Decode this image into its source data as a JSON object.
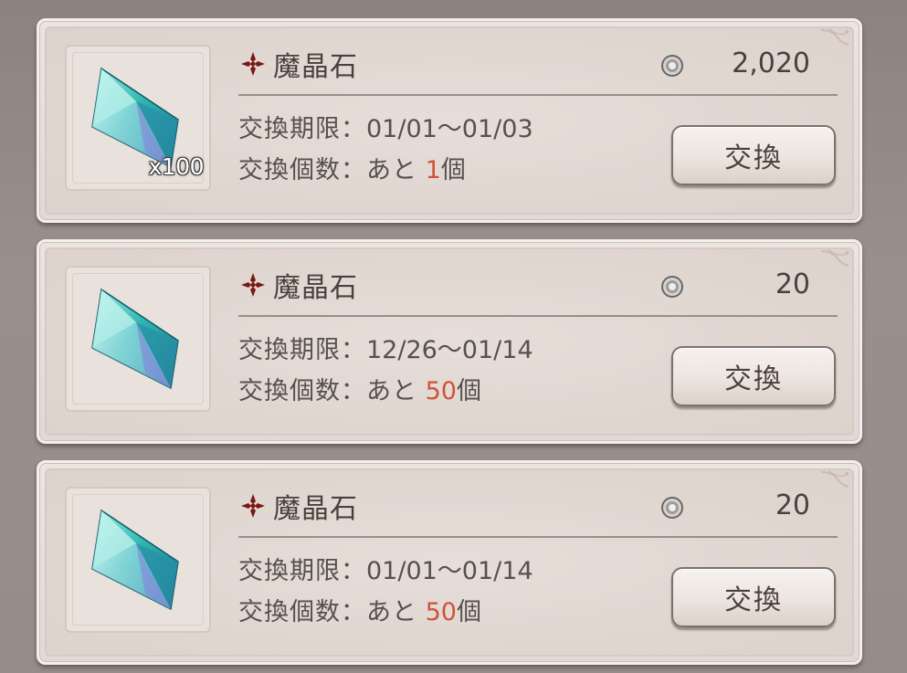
{
  "items": [
    {
      "name": "魔晶石",
      "quantity_badge": "x100",
      "price": "2,020",
      "period_label": "交換期限：",
      "period_value": "01/01～01/03",
      "remaining_label": "交換個数：あと",
      "remaining_count": "1",
      "remaining_unit": "個",
      "button_label": "交換"
    },
    {
      "name": "魔晶石",
      "quantity_badge": "",
      "price": "20",
      "period_label": "交換期限：",
      "period_value": "12/26～01/14",
      "remaining_label": "交換個数：あと",
      "remaining_count": "50",
      "remaining_unit": "個",
      "button_label": "交換"
    },
    {
      "name": "魔晶石",
      "quantity_badge": "",
      "price": "20",
      "period_label": "交換期限：",
      "period_value": "01/01～01/14",
      "remaining_label": "交換個数：あと",
      "remaining_count": "50",
      "remaining_unit": "個",
      "button_label": "交換"
    }
  ],
  "icons": {
    "item": "crystal-icon",
    "name_marker": "cross-ornament-icon",
    "currency": "silver-coin-icon"
  },
  "colors": {
    "remaining_count": "#d0523a",
    "name_marker": "#7a1a14",
    "text": "#4a403c"
  }
}
